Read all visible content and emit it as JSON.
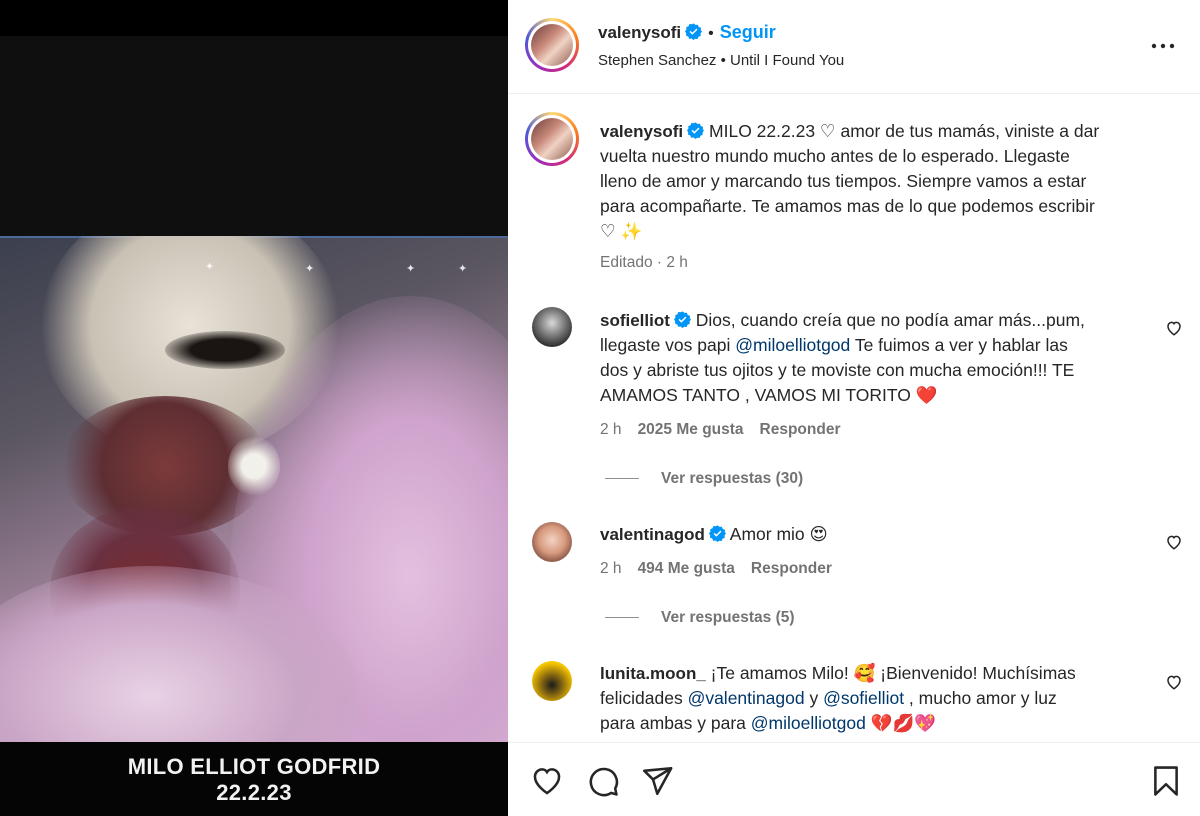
{
  "media": {
    "caption_line1": "MILO ELLIOT GODFRID",
    "caption_line2": "22.2.23"
  },
  "header": {
    "username": "valenysofi",
    "verified": true,
    "separator": "•",
    "follow_label": "Seguir",
    "audio": "Stephen Sanchez • Until I Found You",
    "more_icon": "more-horizontal-icon"
  },
  "caption": {
    "username": "valenysofi",
    "lines": [
      "MILO 22.2.23 ♡ amor de tus mamás, viniste a dar",
      "vuelta nuestro mundo mucho antes de lo esperado. Llegaste",
      "lleno de amor y marcando tus tiempos. Siempre vamos a estar",
      "para acompañarte. Te amamos mas de lo que podemos escribir",
      "♡ ✨"
    ],
    "first_line_text": "MILO 22.2.23 ♡ amor de tus mamás, viniste a dar",
    "meta": "Editado · 2 h"
  },
  "comments": [
    {
      "username": "sofielliot",
      "line1": "Dios, cuando creía que no podía amar más...pum,",
      "line2_prefix": "llegaste vos papi ",
      "line2_mention": "@miloelliotgod",
      "line2_suffix": " Te fuimos a ver y hablar las",
      "line3": "dos y abriste tus ojitos y te moviste con mucha emoción!!! TE",
      "line4": "AMAMOS TANTO , VAMOS MI TORITO ❤️",
      "time": "2 h",
      "likes": "2025 Me gusta",
      "reply": "Responder",
      "view_replies": "Ver respuestas (30)"
    },
    {
      "username": "valentinagod",
      "line1": "Amor mio 😍",
      "time": "2 h",
      "likes": "494 Me gusta",
      "reply": "Responder",
      "view_replies": "Ver respuestas (5)"
    },
    {
      "username": "lunita.moon_",
      "line1": "¡Te amamos Milo! 🥰 ¡Bienvenido! Muchísimas",
      "line2_prefix": "felicidades ",
      "line2_mention1": "@valentinagod",
      "line2_mid": " y ",
      "line2_mention2": "@sofielliot",
      "line2_suffix": " , mucho amor y luz",
      "line3_prefix": "para ambas y para ",
      "line3_mention": "@miloelliotgod",
      "line3_suffix": " 💔💋💖"
    }
  ],
  "actions": {
    "like_icon": "heart-icon",
    "comment_icon": "comment-icon",
    "share_icon": "send-icon",
    "save_icon": "bookmark-icon"
  },
  "colors": {
    "link": "#0095f6",
    "mention": "#00376b",
    "verified": "#0095f6",
    "secondary_text": "#737373"
  }
}
